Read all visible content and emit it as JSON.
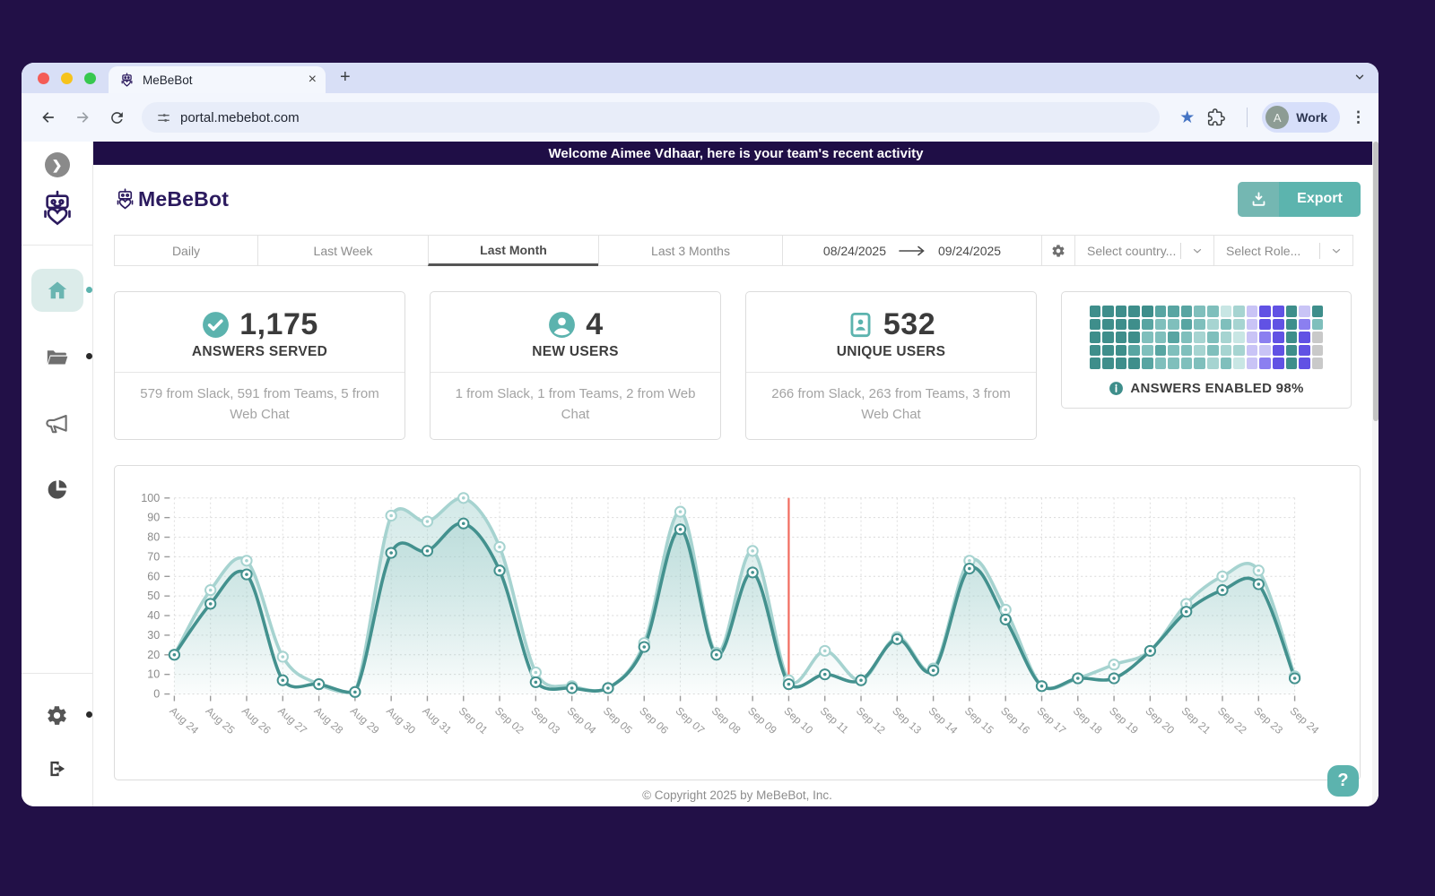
{
  "window": {
    "tab_title": "MeBeBot",
    "url": "portal.mebebot.com",
    "profile_label": "Work",
    "profile_initial": "A"
  },
  "banner": {
    "text": "Welcome Aimee Vdhaar, here is your team's recent activity"
  },
  "header": {
    "brand": "MeBeBot",
    "export_label": "Export"
  },
  "filters": {
    "tabs": [
      {
        "label": "Daily",
        "active": false
      },
      {
        "label": "Last Week",
        "active": false
      },
      {
        "label": "Last Month",
        "active": true
      },
      {
        "label": "Last 3 Months",
        "active": false
      }
    ],
    "date_from": "08/24/2025",
    "date_to": "09/24/2025",
    "country_placeholder": "Select country...",
    "role_placeholder": "Select Role..."
  },
  "stats": [
    {
      "icon": "check-circle-icon",
      "value": "1,175",
      "label": "ANSWERS SERVED",
      "detail": "579 from Slack, 591 from Teams, 5 from Web Chat"
    },
    {
      "icon": "user-circle-icon",
      "value": "4",
      "label": "NEW USERS",
      "detail": "1 from Slack, 1 from Teams, 2 from Web Chat"
    },
    {
      "icon": "badge-icon",
      "value": "532",
      "label": "UNIQUE USERS",
      "detail": "266 from Slack, 263 from Teams, 3 from Web Chat"
    }
  ],
  "heatmap": {
    "label": "ANSWERS ENABLED 98%",
    "palette": {
      "d": "#3E8E8B",
      "m": "#58A5A2",
      "t": "#7FBFBC",
      "l": "#A6D4D1",
      "L": "#C8E6E4",
      "v": "#C9C4F6",
      "p": "#8B7FF0",
      "P": "#6152E4",
      "g": "#C9C9C9"
    },
    "grid": [
      "dddddmmmttLlvPPdvd",
      "ddddmttmtltlvPPdpt",
      "ddddttmtltlLvpPdPg",
      "dddmtmttltllvvPdPg",
      "ddddmttttltLvpPdPg"
    ]
  },
  "chart_data": {
    "type": "area-line",
    "x": [
      "Aug 24",
      "Aug 25",
      "Aug 26",
      "Aug 27",
      "Aug 28",
      "Aug 29",
      "Aug 30",
      "Aug 31",
      "Sep 01",
      "Sep 02",
      "Sep 03",
      "Sep 04",
      "Sep 05",
      "Sep 06",
      "Sep 07",
      "Sep 08",
      "Sep 09",
      "Sep 10",
      "Sep 11",
      "Sep 12",
      "Sep 13",
      "Sep 14",
      "Sep 15",
      "Sep 16",
      "Sep 17",
      "Sep 18",
      "Sep 19",
      "Sep 20",
      "Sep 21",
      "Sep 22",
      "Sep 23",
      "Sep 24"
    ],
    "series": [
      {
        "name": "light-teal",
        "color": "#A6D3D0",
        "values": [
          20,
          53,
          68,
          19,
          5,
          1,
          91,
          88,
          100,
          75,
          11,
          4,
          3,
          26,
          93,
          21,
          73,
          7,
          22,
          7,
          29,
          13,
          68,
          43,
          4,
          8,
          15,
          22,
          46,
          60,
          63,
          9
        ]
      },
      {
        "name": "dark-teal",
        "color": "#43918E",
        "values": [
          20,
          46,
          61,
          7,
          5,
          1,
          72,
          73,
          87,
          63,
          6,
          3,
          3,
          24,
          84,
          20,
          62,
          5,
          10,
          7,
          28,
          12,
          64,
          38,
          4,
          8,
          8,
          22,
          42,
          53,
          56,
          8
        ]
      }
    ],
    "ylim": [
      0,
      100
    ],
    "ytick_step": 10,
    "grid": "dotted",
    "legend": "none",
    "annotation_line": {
      "x": "Sep 10",
      "color": "#F26C5F"
    }
  },
  "footer": {
    "copyright": "© Copyright 2025 by MeBeBot, Inc."
  },
  "help": {
    "label": "?"
  },
  "colors": {
    "accent_teal": "#5CB3AE",
    "banner_purple": "#1F0E46",
    "brand_purple": "#2B1A5E",
    "background_purple": "#221047",
    "annotation_red": "#F26C5F"
  }
}
